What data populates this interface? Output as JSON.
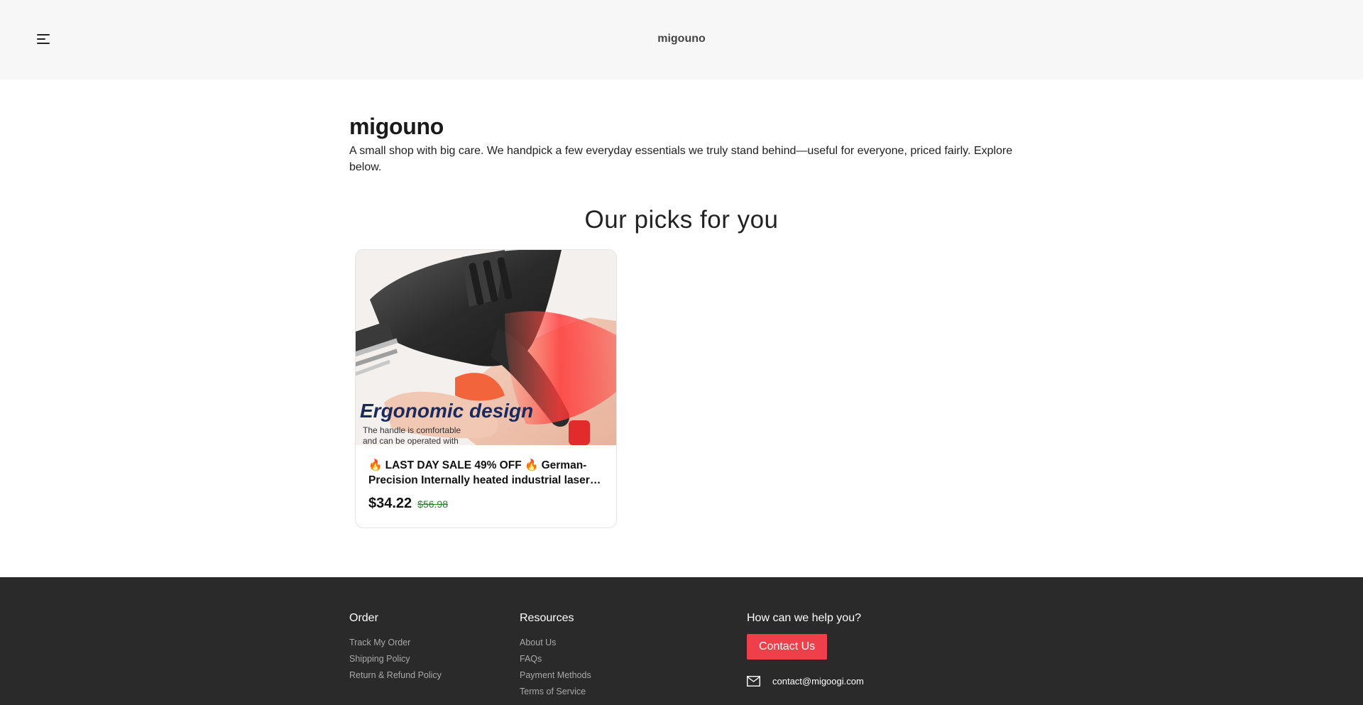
{
  "header": {
    "brand": "migouno",
    "menu_icon": "hamburger-menu-icon"
  },
  "intro": {
    "title": "migouno",
    "description": "A small shop with big care. We handpick a few everyday essentials we truly stand behind—useful for everyone, priced fairly. Explore below."
  },
  "picks": {
    "heading": "Our picks for you",
    "products": [
      {
        "title": "🔥 LAST DAY SALE 49% OFF 🔥 German-Precision Internally heated industrial laser soldering gun",
        "price": "$34.22",
        "compare_price": "$56.98",
        "image_text": {
          "headline": "Ergonomic design",
          "caption_line1": "The handle is comfortable",
          "caption_line2": "and can be operated with"
        }
      }
    ]
  },
  "footer": {
    "order": {
      "heading": "Order",
      "links": [
        "Track My Order",
        "Shipping Policy",
        "Return & Refund Policy"
      ]
    },
    "resources": {
      "heading": "Resources",
      "links": [
        "About Us",
        "FAQs",
        "Payment Methods",
        "Terms of Service"
      ]
    },
    "help": {
      "heading": "How can we help you?",
      "contact_button": "Contact Us",
      "email": "contact@migoogi.com",
      "email_icon": "mail-icon"
    }
  },
  "colors": {
    "header_bg": "#f7f7f7",
    "footer_bg": "#2a2a2a",
    "accent": "#ee3f4a",
    "compare_price": "#2e7d32"
  }
}
